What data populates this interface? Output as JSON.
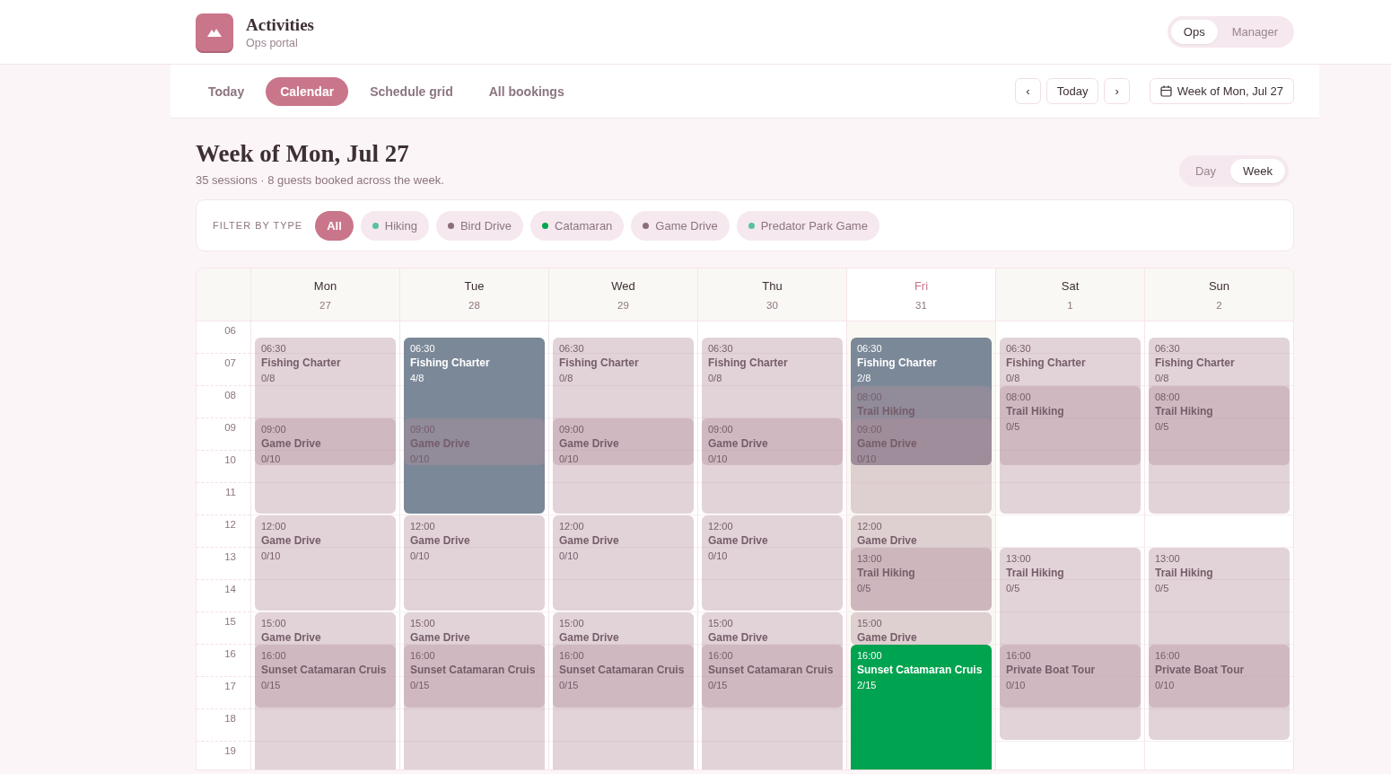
{
  "brand": {
    "title": "Activities",
    "subtitle": "Ops portal"
  },
  "role_switch": [
    {
      "label": "Ops",
      "selected": true
    },
    {
      "label": "Manager",
      "selected": false
    }
  ],
  "nav_tabs": [
    {
      "label": "Today",
      "selected": false
    },
    {
      "label": "Calendar",
      "selected": true
    },
    {
      "label": "Schedule grid",
      "selected": false
    },
    {
      "label": "All bookings",
      "selected": false
    }
  ],
  "week_nav": {
    "prev": "‹",
    "today": "Today",
    "next": "›",
    "range": "Week of Mon, Jul 27"
  },
  "heading": {
    "title": "Week of Mon, Jul 27",
    "summary": "35 sessions · 8 guests booked across the week."
  },
  "view_switch": [
    {
      "label": "Day",
      "selected": false
    },
    {
      "label": "Week",
      "selected": true
    }
  ],
  "filter": {
    "label": "FILTER BY TYPE",
    "chips": [
      {
        "label": "All",
        "selected": true
      },
      {
        "label": "Hiking",
        "selected": false,
        "color": "#5cc0a0"
      },
      {
        "label": "Bird Drive",
        "selected": false,
        "color": "#8a6f7a"
      },
      {
        "label": "Catamaran",
        "selected": false,
        "color": "#00a34f"
      },
      {
        "label": "Game Drive",
        "selected": false,
        "color": "#8a6f7a"
      },
      {
        "label": "Predator Park Game",
        "selected": false,
        "color": "#5cc0a0"
      }
    ]
  },
  "hours": [
    "06",
    "07",
    "08",
    "09",
    "10",
    "11",
    "12",
    "13",
    "14",
    "15",
    "16",
    "17",
    "18",
    "19"
  ],
  "days": [
    {
      "name": "Mon",
      "date": "27",
      "today": false,
      "events": [
        {
          "time": "06:30",
          "title": "Fishing Charter",
          "count": "0/8",
          "faded": true
        },
        {
          "time": "09:00",
          "title": "Game Drive",
          "count": "0/10",
          "faded": true
        },
        {
          "time": "12:00",
          "title": "Game Drive",
          "count": "0/10",
          "faded": true
        },
        {
          "time": "15:00",
          "title": "Game Drive",
          "faded": true
        },
        {
          "time": "16:00",
          "title": "Sunset Catamaran Cruis",
          "count": "0/15",
          "faded": true
        }
      ]
    },
    {
      "name": "Tue",
      "date": "28",
      "today": false,
      "events": [
        {
          "time": "06:30",
          "title": "Fishing Charter",
          "count": "4/8",
          "faded": false,
          "color": "#7b8898"
        },
        {
          "time": "09:00",
          "title": "Game Drive",
          "count": "0/10",
          "faded": true
        },
        {
          "time": "12:00",
          "title": "Game Drive",
          "count": "0/10",
          "faded": true
        },
        {
          "time": "15:00",
          "title": "Game Drive",
          "faded": true
        },
        {
          "time": "16:00",
          "title": "Sunset Catamaran Cruis",
          "count": "0/15",
          "faded": true
        }
      ]
    },
    {
      "name": "Wed",
      "date": "29",
      "today": false,
      "events": [
        {
          "time": "06:30",
          "title": "Fishing Charter",
          "count": "0/8",
          "faded": true
        },
        {
          "time": "09:00",
          "title": "Game Drive",
          "count": "0/10",
          "faded": true
        },
        {
          "time": "12:00",
          "title": "Game Drive",
          "count": "0/10",
          "faded": true
        },
        {
          "time": "15:00",
          "title": "Game Drive",
          "faded": true
        },
        {
          "time": "16:00",
          "title": "Sunset Catamaran Cruis",
          "count": "0/15",
          "faded": true
        }
      ]
    },
    {
      "name": "Thu",
      "date": "30",
      "today": false,
      "events": [
        {
          "time": "06:30",
          "title": "Fishing Charter",
          "count": "0/8",
          "faded": true
        },
        {
          "time": "09:00",
          "title": "Game Drive",
          "count": "0/10",
          "faded": true
        },
        {
          "time": "12:00",
          "title": "Game Drive",
          "count": "0/10",
          "faded": true
        },
        {
          "time": "15:00",
          "title": "Game Drive",
          "faded": true
        },
        {
          "time": "16:00",
          "title": "Sunset Catamaran Cruis",
          "count": "0/15",
          "faded": true
        }
      ]
    },
    {
      "name": "Fri",
      "date": "31",
      "today": true,
      "events": [
        {
          "time": "06:30",
          "title": "Fishing Charter",
          "count": "2/8",
          "faded": false,
          "color": "#7b8898"
        },
        {
          "time": "08:00",
          "title": "Trail Hiking",
          "faded": true
        },
        {
          "time": "09:00",
          "title": "Game Drive",
          "count": "0/10",
          "faded": true
        },
        {
          "time": "12:00",
          "title": "Game Drive",
          "faded": true
        },
        {
          "time": "13:00",
          "title": "Trail Hiking",
          "count": "0/5",
          "faded": true
        },
        {
          "time": "15:00",
          "title": "Game Drive",
          "faded": true
        },
        {
          "time": "16:00",
          "title": "Sunset Catamaran Cruis",
          "count": "2/15",
          "faded": false,
          "color": "#00a34f"
        }
      ]
    },
    {
      "name": "Sat",
      "date": "1",
      "today": false,
      "events": [
        {
          "time": "06:30",
          "title": "Fishing Charter",
          "count": "0/8",
          "faded": true
        },
        {
          "time": "08:00",
          "title": "Trail Hiking",
          "count": "0/5",
          "faded": true
        },
        {
          "time": "13:00",
          "title": "Trail Hiking",
          "count": "0/5",
          "faded": true
        },
        {
          "time": "16:00",
          "title": "Private Boat Tour",
          "count": "0/10",
          "faded": true
        }
      ]
    },
    {
      "name": "Sun",
      "date": "2",
      "today": false,
      "events": [
        {
          "time": "06:30",
          "title": "Fishing Charter",
          "count": "0/8",
          "faded": true
        },
        {
          "time": "08:00",
          "title": "Trail Hiking",
          "count": "0/5",
          "faded": true
        },
        {
          "time": "13:00",
          "title": "Trail Hiking",
          "count": "0/5",
          "faded": true
        },
        {
          "time": "16:00",
          "title": "Private Boat Tour",
          "count": "0/10",
          "faded": true
        }
      ]
    }
  ]
}
